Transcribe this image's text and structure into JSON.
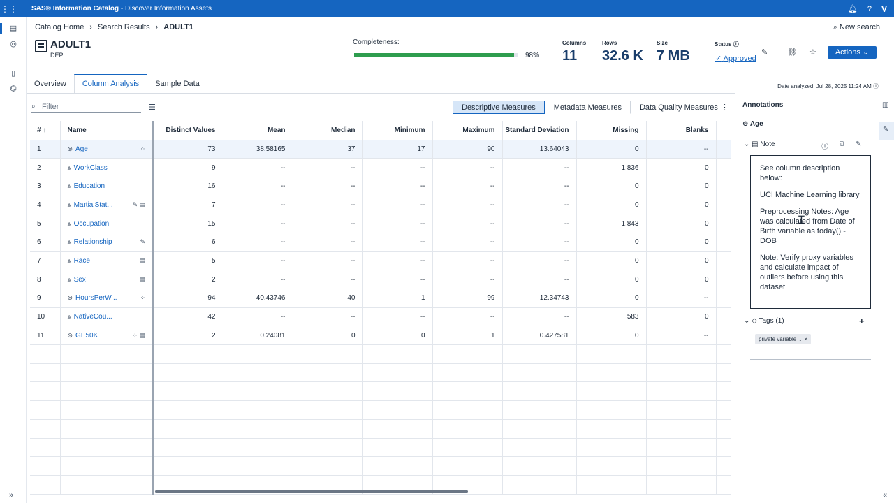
{
  "app": {
    "brand": "SAS® Information Catalog",
    "title_sep": " - ",
    "page_title": "Discover Information Assets",
    "user_initial": "V",
    "bell_icon": "bell-icon",
    "help_label": "?"
  },
  "breadcrumb": {
    "items": [
      "Catalog Home",
      "Search Results"
    ],
    "current": "ADULT1",
    "separator": "›"
  },
  "new_search": "New search",
  "dataset": {
    "name": "ADULT1",
    "library": "DEP"
  },
  "completeness": {
    "label": "Completeness:",
    "percent_text": "98%",
    "fraction": 0.98
  },
  "metrics": {
    "columns_label": "Columns",
    "columns_value": "11",
    "rows_label": "Rows",
    "rows_value": "32.6 K",
    "size_label": "Size",
    "size_value": "7 MB",
    "status_label": "Status",
    "status_value": "Approved"
  },
  "actions_label": "Actions ⌄",
  "tabs": [
    "Overview",
    "Column Analysis",
    "Sample Data"
  ],
  "date_analyzed": "Date analyzed: Jul 28, 2025 11:24 AM",
  "filter_placeholder": "Filter",
  "measures": {
    "descriptive": "Descriptive Measures",
    "metadata": "Metadata Measures",
    "quality": "Data Quality Measures"
  },
  "table": {
    "headers": [
      "#",
      "Name",
      "Distinct Values",
      "Mean",
      "Median",
      "Minimum",
      "Maximum",
      "Standard Deviation",
      "Missing",
      "Blanks"
    ],
    "sort_indicator": "↑",
    "rows": [
      {
        "idx": "1",
        "name": "Age",
        "type": "numeric",
        "distinct": "73",
        "mean": "38.58165",
        "median": "37",
        "min": "17",
        "max": "90",
        "std": "13.64043",
        "missing": "0",
        "blanks": "--"
      },
      {
        "idx": "2",
        "name": "WorkClass",
        "type": "char",
        "distinct": "9",
        "mean": "--",
        "median": "--",
        "min": "--",
        "max": "--",
        "std": "--",
        "missing": "1,836",
        "blanks": "0"
      },
      {
        "idx": "3",
        "name": "Education",
        "type": "char",
        "distinct": "16",
        "mean": "--",
        "median": "--",
        "min": "--",
        "max": "--",
        "std": "--",
        "missing": "0",
        "blanks": "0"
      },
      {
        "idx": "4",
        "name": "MartialStat...",
        "type": "char",
        "distinct": "7",
        "mean": "--",
        "median": "--",
        "min": "--",
        "max": "--",
        "std": "--",
        "missing": "0",
        "blanks": "0"
      },
      {
        "idx": "5",
        "name": "Occupation",
        "type": "char",
        "distinct": "15",
        "mean": "--",
        "median": "--",
        "min": "--",
        "max": "--",
        "std": "--",
        "missing": "1,843",
        "blanks": "0"
      },
      {
        "idx": "6",
        "name": "Relationship",
        "type": "char",
        "distinct": "6",
        "mean": "--",
        "median": "--",
        "min": "--",
        "max": "--",
        "std": "--",
        "missing": "0",
        "blanks": "0"
      },
      {
        "idx": "7",
        "name": "Race",
        "type": "char",
        "distinct": "5",
        "mean": "--",
        "median": "--",
        "min": "--",
        "max": "--",
        "std": "--",
        "missing": "0",
        "blanks": "0"
      },
      {
        "idx": "8",
        "name": "Sex",
        "type": "char",
        "distinct": "2",
        "mean": "--",
        "median": "--",
        "min": "--",
        "max": "--",
        "std": "--",
        "missing": "0",
        "blanks": "0"
      },
      {
        "idx": "9",
        "name": "HoursPerW...",
        "type": "numeric",
        "distinct": "94",
        "mean": "40.43746",
        "median": "40",
        "min": "1",
        "max": "99",
        "std": "12.34743",
        "missing": "0",
        "blanks": "--"
      },
      {
        "idx": "10",
        "name": "NativeCou...",
        "type": "char",
        "distinct": "42",
        "mean": "--",
        "median": "--",
        "min": "--",
        "max": "--",
        "std": "--",
        "missing": "583",
        "blanks": "0"
      },
      {
        "idx": "11",
        "name": "GE50K",
        "type": "numeric",
        "distinct": "2",
        "mean": "0.24081",
        "median": "0",
        "min": "0",
        "max": "1",
        "std": "0.427581",
        "missing": "0",
        "blanks": "--"
      }
    ]
  },
  "annotations": {
    "title": "Annotations",
    "column": "Age",
    "note_label": "Note",
    "note_lines": [
      "See column description below:",
      "UCI Machine Learning library",
      "Preprocessing Notes: Age was calculated from Date of Birth variable as today() - DOB",
      "Note: Verify proxy variables and calculate impact of outliers before using this dataset"
    ],
    "tags_label": "Tags (1)",
    "tag": "private variable",
    "tag_remove": "×",
    "add_label": "+"
  },
  "colors": {
    "brand_blue": "#1565c0",
    "completeness_green": "#2e9d4e",
    "metric_text": "#1a3e6b"
  }
}
